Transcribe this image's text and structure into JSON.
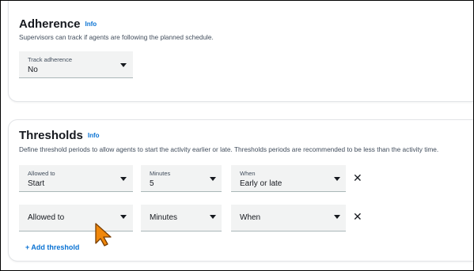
{
  "adherence": {
    "title": "Adherence",
    "info": "Info",
    "description": "Supervisors can track if agents are following the planned schedule.",
    "track_select": {
      "label": "Track adherence",
      "value": "No"
    }
  },
  "thresholds": {
    "title": "Thresholds",
    "info": "Info",
    "description": "Define threshold periods to allow agents to start the activity earlier or late. Thresholds periods are recommended to be less than the activity time.",
    "rows": [
      {
        "allowed_to": {
          "label": "Allowed to",
          "value": "Start"
        },
        "minutes": {
          "label": "Minutes",
          "value": "5"
        },
        "when": {
          "label": "When",
          "value": "Early or late"
        },
        "remove": "✕"
      },
      {
        "allowed_to": {
          "placeholder": "Allowed to"
        },
        "minutes": {
          "placeholder": "Minutes"
        },
        "when": {
          "placeholder": "When"
        },
        "remove": "✕"
      }
    ],
    "add_label": "+ Add threshold"
  },
  "cursor": {
    "icon": "pointer-arrow-icon",
    "color": "#f0870a"
  },
  "colors": {
    "link": "#0972d3",
    "field_bg": "#f2f3f3"
  }
}
